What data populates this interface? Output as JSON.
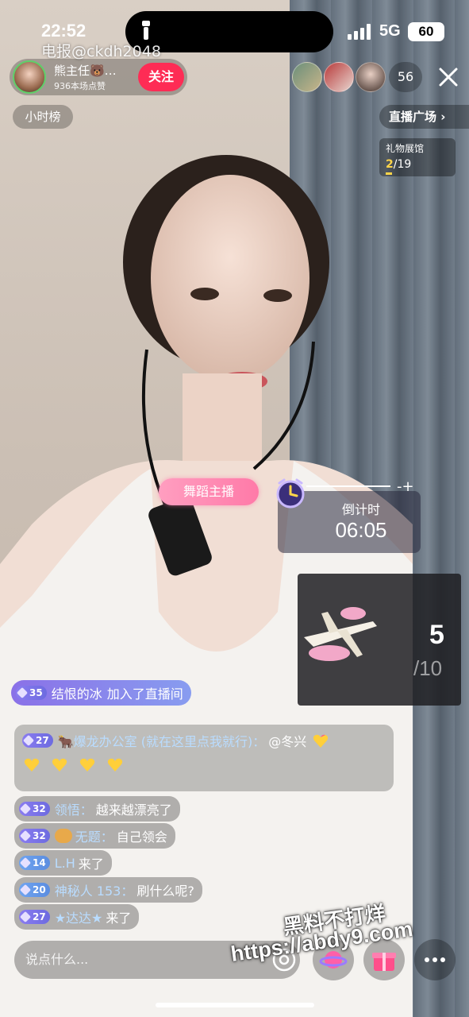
{
  "status_bar": {
    "time": "22:52",
    "network": "5G",
    "battery": "60"
  },
  "watermark_top": "电报@ckdh2048",
  "host": {
    "name": "熊主任🐻…",
    "likes": "936本场点赞",
    "follow_label": "关注"
  },
  "viewers": {
    "count": "56"
  },
  "tags": {
    "hour_rank": "小时榜",
    "plaza": "直播广场 ›"
  },
  "gift_hall": {
    "title": "礼物展馆",
    "current": "2",
    "total": "/19"
  },
  "dance_tag": "舞蹈主播",
  "countdown": {
    "label": "倒计时",
    "value": "06:05"
  },
  "gift_box": {
    "count": "5",
    "total": "/10"
  },
  "chat": {
    "join": {
      "level": "35",
      "user": "结恨的冰",
      "text": "加入了直播间"
    },
    "big": {
      "level": "27",
      "user": "🐂爆龙办公室 (就在这里点我就行)：",
      "text": "@冬兴"
    },
    "messages": [
      {
        "level": "32",
        "user": "领悟：",
        "text": "越来越漂亮了"
      },
      {
        "level": "32",
        "user": "无题：",
        "text": "自己领会"
      },
      {
        "level": "14",
        "user": "L.H",
        "text": "来了"
      },
      {
        "level": "20",
        "user": "神秘人 153：",
        "text": "刷什么呢?"
      },
      {
        "level": "27",
        "user": "★达达★",
        "text": "来了"
      }
    ]
  },
  "input": {
    "placeholder": "说点什么..."
  },
  "watermark_big": {
    "line1": "黑料不打烊",
    "line2": "https://abdy9.com"
  }
}
